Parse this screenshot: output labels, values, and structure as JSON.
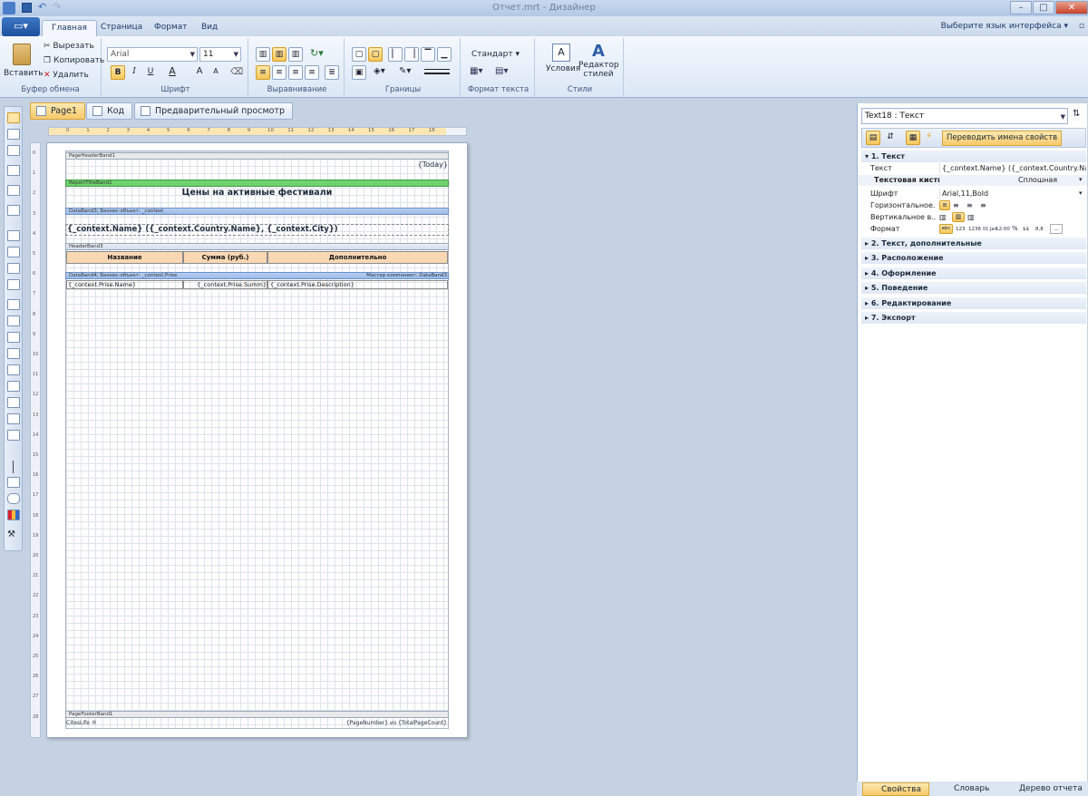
{
  "window": {
    "title": "Отчет.mrt - Дизайнер",
    "lang_label": "Выберите язык интерфейса"
  },
  "ribbon_tabs": [
    "Главная",
    "Страница",
    "Формат",
    "Вид"
  ],
  "clipboard": {
    "paste": "Вставить",
    "cut": "Вырезать",
    "copy": "Копировать",
    "delete": "Удалить",
    "label": "Буфер обмена"
  },
  "font": {
    "family": "Arial",
    "size": "11",
    "label": "Шрифт",
    "bold": "B",
    "italic": "I",
    "underline": "U",
    "color": "A",
    "grow": "A",
    "shrink": "A"
  },
  "align": {
    "label": "Выравнивание"
  },
  "borders": {
    "label": "Границы"
  },
  "textformat": {
    "value": "Стандарт",
    "label": "Формат текста"
  },
  "styles": {
    "conditions": "Условия",
    "style_designer_1": "Редактор",
    "style_designer_2": "стилей",
    "label": "Стили"
  },
  "doc_tabs": [
    "Page1",
    "Код",
    "Предварительный просмотр"
  ],
  "ruler_ticks": [
    "0",
    "1",
    "2",
    "3",
    "4",
    "5",
    "6",
    "7",
    "8",
    "9",
    "10",
    "11",
    "12",
    "13",
    "14",
    "15",
    "16",
    "17",
    "18"
  ],
  "vruler_ticks": [
    "0",
    "1",
    "2",
    "3",
    "4",
    "5",
    "6",
    "7",
    "8",
    "9",
    "10",
    "11",
    "12",
    "13",
    "14",
    "15",
    "16",
    "17",
    "18",
    "19",
    "20",
    "21",
    "22",
    "23",
    "24",
    "25",
    "26",
    "27",
    "28"
  ],
  "report": {
    "page_header_band": "PageHeaderBand1",
    "today": "{Today}",
    "title_band": "ReportTitleBand1",
    "title": "Цены на активные фестивали",
    "data_band3": "DataBand3; Бизнес-объект: _context",
    "context_text": "{_context.Name} ({_context.Country.Name}, {_context.City})",
    "header_band": "HeaderBand3",
    "headers": [
      "Название",
      "Сумма (руб.)",
      "Дополнительно"
    ],
    "data_band4": "DataBand4; Бизнес-объект: _context.Prise",
    "master": "Мастер компонент: DataBand3",
    "cells": [
      "{_context.Prise.Name}",
      "{_context.Prise.Summ}",
      "{_context.Prise.Description}"
    ],
    "footer_band": "PageFooterBand1",
    "footer_left": "CitesLife ®",
    "footer_right": "{PageNumber} из {TotalPageCount}"
  },
  "props": {
    "selector": "Text18 : Текст",
    "translate_btn": "Переводить имена свойств",
    "cat1": "1. Текст",
    "rows": [
      {
        "name": "Текст",
        "value": "{_context.Name} ({_context.Country.Name},"
      },
      {
        "name": "Текстовая кисть",
        "value": "Сплошная"
      },
      {
        "name": "Шрифт",
        "value": "Arial,11,Bold"
      },
      {
        "name": "Горизонтальное...",
        "value": ""
      },
      {
        "name": "Вертикальное в...",
        "value": ""
      },
      {
        "name": "Формат",
        "value": ""
      }
    ],
    "categories": [
      "2. Текст, дополнительные",
      "3. Расположение",
      "4. Оформление",
      "5. Поведение",
      "6. Редактирование",
      "7. Экспорт"
    ],
    "format_items": [
      "abc",
      "123",
      "1236",
      "01 Jan",
      "12:00",
      "%",
      "$$",
      "8,8",
      "..."
    ]
  },
  "bottom_tabs": [
    "Свойства",
    "Словарь",
    "Дерево отчета"
  ]
}
